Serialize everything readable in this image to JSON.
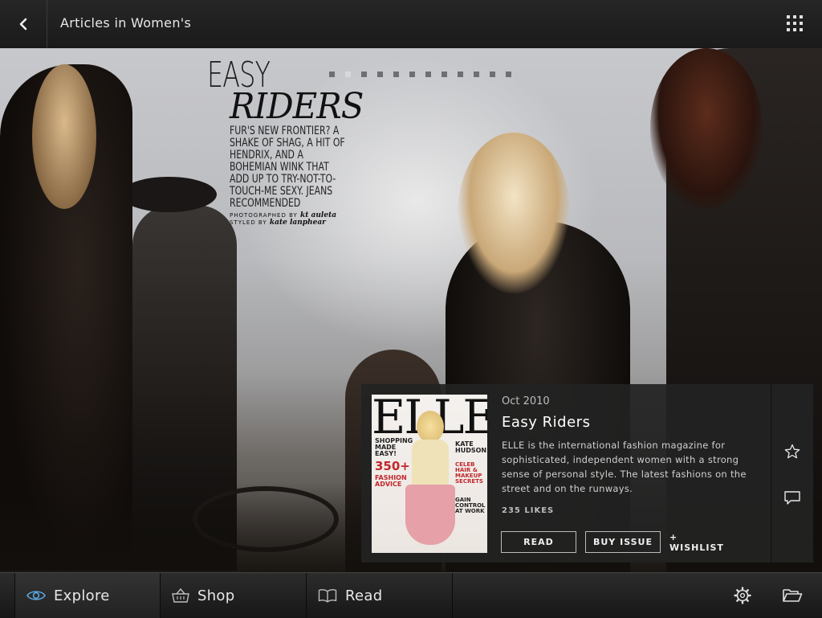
{
  "header": {
    "back_icon": "chevron-left-icon",
    "title": "Articles in Women's",
    "menu_icon": "grid-icon"
  },
  "hero": {
    "headline_line1": "EASY",
    "headline_line2": "RIDERS",
    "deck": "FUR'S NEW FRONTIER? A SHAKE OF SHAG, A HIT OF HENDRIX, AND A BOHEMIAN WINK THAT ADD UP TO TRY-NOT-TO-TOUCH-ME SEXY. JEANS RECOMMENDED",
    "credit_photo_label": "PHOTOGRAPHED BY",
    "credit_photo_name": "kt auleta",
    "credit_style_label": "STYLED BY",
    "credit_style_name": "kate lanphear",
    "page_count": 12,
    "active_page": 2
  },
  "article": {
    "cover": {
      "masthead": "ELLE",
      "cover_line_1": "SHOPPING MADE EASY!",
      "cover_line_2": "350+",
      "cover_line_3": "FASHION ADVICE",
      "cover_line_4": "KATE HUDSON",
      "cover_line_5": "CELEB HAIR & MAKEUP SECRETS",
      "cover_line_6": "GAIN CONTROL AT WORK"
    },
    "date": "Oct 2010",
    "title": "Easy Riders",
    "description": "ELLE is the international fashion magazine for sophisticated, independent women with a strong sense of personal style. The latest fashions on the street and on the runways.",
    "likes": "235 LIKES",
    "read_label": "READ",
    "buy_label": "BUY ISSUE",
    "wishlist_label": "+ WISHLIST",
    "favorite_icon": "star-icon",
    "comment_icon": "comment-icon"
  },
  "bottom_nav": {
    "tabs": [
      {
        "label": "Explore",
        "icon": "eye-icon",
        "active": true
      },
      {
        "label": "Shop",
        "icon": "basket-icon",
        "active": false
      },
      {
        "label": "Read",
        "icon": "open-book-icon",
        "active": false
      }
    ],
    "settings_icon": "gear-icon",
    "library_icon": "folder-icon"
  }
}
